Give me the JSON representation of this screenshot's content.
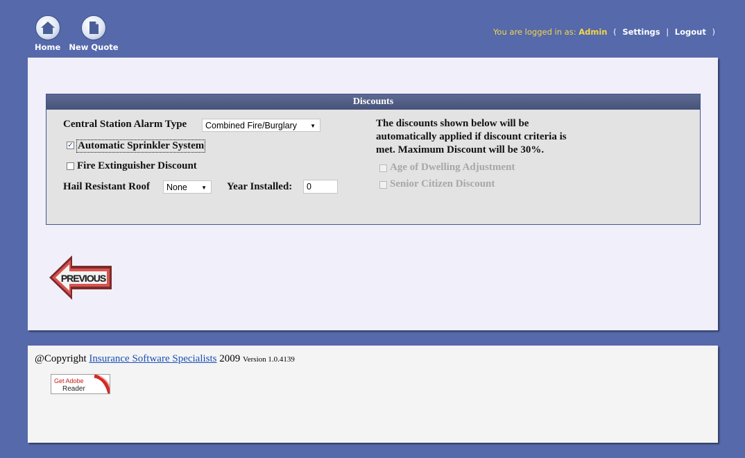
{
  "topnav": {
    "home_label": "Home",
    "new_quote_label": "New Quote"
  },
  "userbar": {
    "prefix": "You are logged in as:",
    "username": "Admin",
    "open_paren": "(",
    "settings_label": "Settings",
    "divider": "|",
    "logout_label": "Logout",
    "close_paren": ")"
  },
  "discounts": {
    "title": "Discounts",
    "alarm_label": "Central Station Alarm Type",
    "alarm_value": "Combined Fire/Burglary",
    "sprinkler_label": "Automatic Sprinkler System",
    "sprinkler_checked": true,
    "extinguisher_label": "Fire Extinguisher Discount",
    "extinguisher_checked": false,
    "hail_label": "Hail Resistant Roof",
    "hail_value": "None",
    "year_label": "Year Installed:",
    "year_value": "0",
    "note": "The discounts shown below will be automatically applied if discount criteria is met. Maximum Discount will be 30%.",
    "age_label": "Age of Dwelling Adjustment",
    "senior_label": "Senior Citizen Discount"
  },
  "previous_label": "PREVIOUS",
  "footer": {
    "copyright_prefix": "@Copyright",
    "company_link": "Insurance Software Specialists",
    "year": "2009",
    "version": "Version 1.0.4139",
    "adobe_get": "Get Adobe",
    "adobe_reader": "Reader"
  },
  "colors": {
    "page_background": "#5569ab",
    "header_bar": "#4e5a82",
    "username": "#f5d64a",
    "link": "#1a4fb6"
  }
}
